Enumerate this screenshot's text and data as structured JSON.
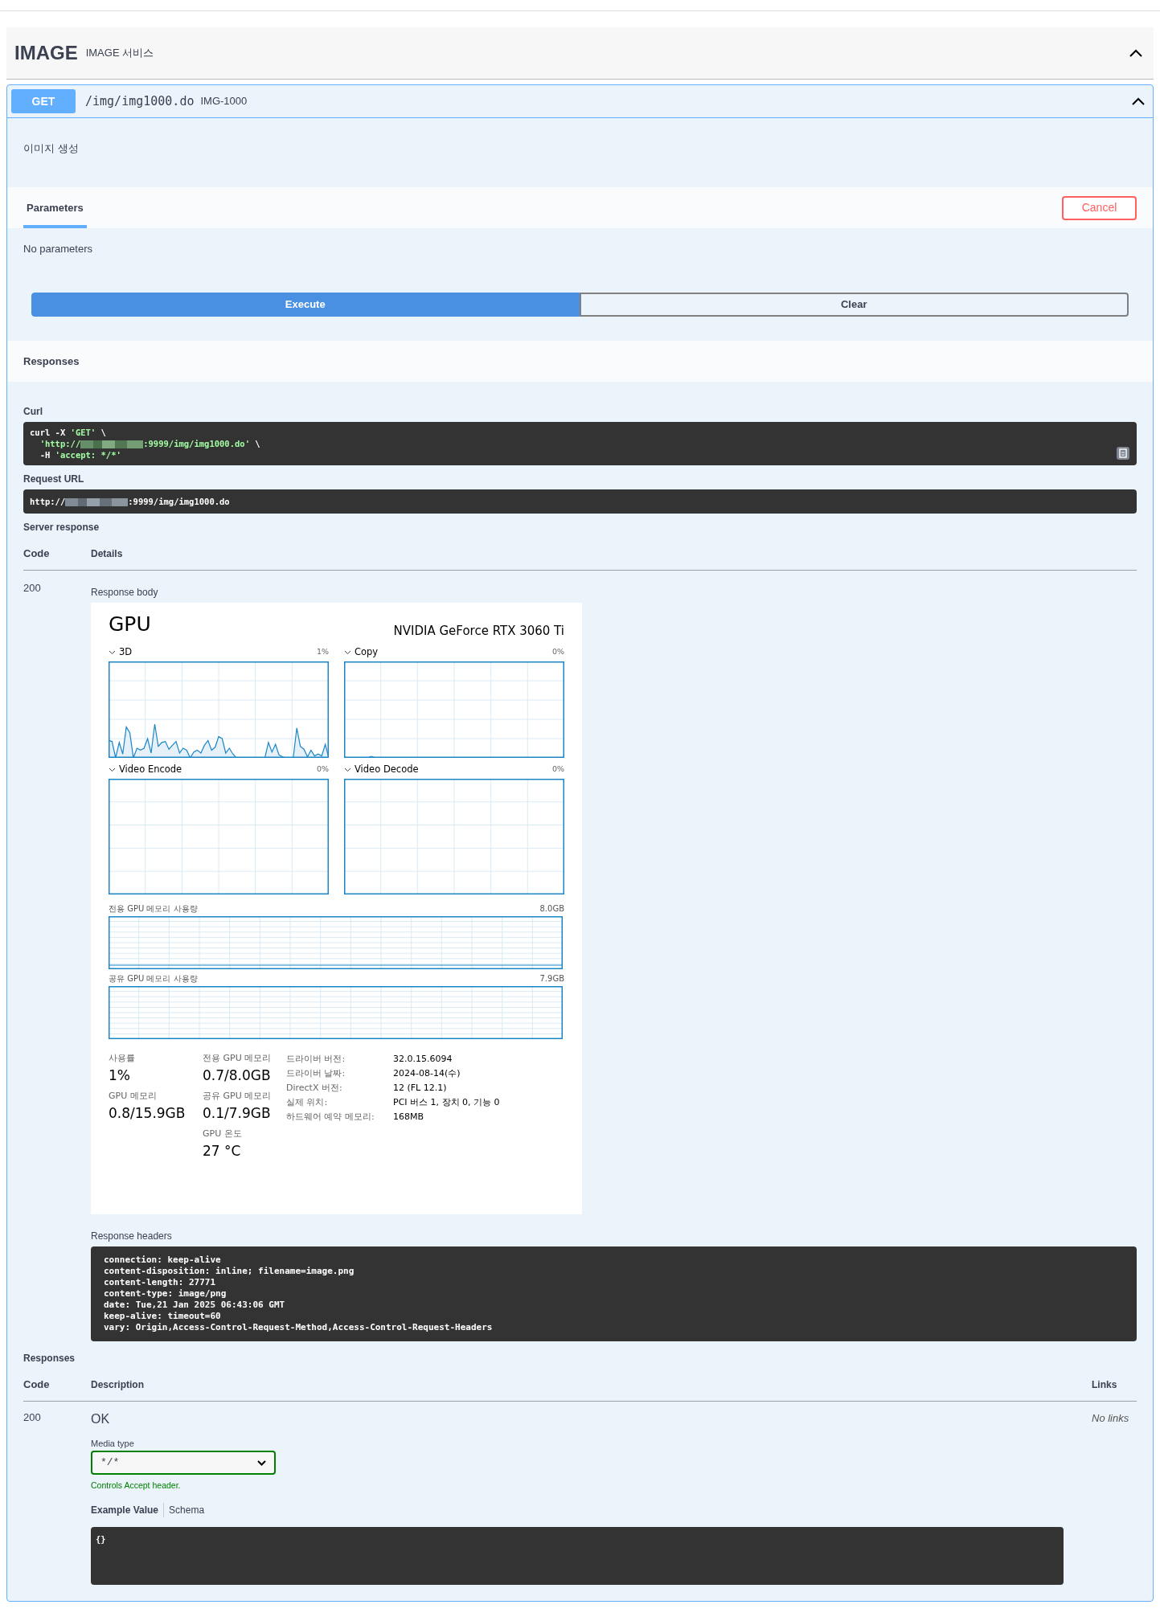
{
  "tag": {
    "name": "IMAGE",
    "description": "IMAGE 서비스",
    "expanded": true
  },
  "operation": {
    "method": "GET",
    "path": "/img/img1000.do",
    "summary": "IMG-1000",
    "expanded": true,
    "description": "이미지 생성"
  },
  "parameters": {
    "tab": {
      "label": "Parameters",
      "selected": true
    },
    "cancel": "Cancel",
    "empty": "No parameters"
  },
  "actions": [
    {
      "label": "Execute",
      "kind": "primary"
    },
    {
      "label": "Clear",
      "kind": "outline"
    }
  ],
  "responses_bar": "Responses",
  "curl": {
    "label": "Curl",
    "lines": [
      [
        {
          "text": "curl -X "
        },
        {
          "text": "'GET'",
          "kind": "string"
        },
        {
          "text": " \\"
        }
      ],
      [
        {
          "text": "  'http://",
          "kind": "string"
        },
        {
          "kind": "blur"
        },
        {
          "text": ":9999/img/img1000.do'",
          "kind": "string"
        },
        {
          "text": " \\"
        }
      ],
      [
        {
          "text": "  -H "
        },
        {
          "text": "'accept: */*'",
          "kind": "string"
        }
      ]
    ]
  },
  "request_url": {
    "label": "Request URL",
    "parts": [
      {
        "text": "http://"
      },
      {
        "kind": "blur"
      },
      {
        "text": ":9999/img/img1000.do"
      }
    ]
  },
  "server_response": {
    "label": "Server response",
    "columns": [
      "Code",
      "Details"
    ],
    "code": "200",
    "body_label": "Response body",
    "gpu": {
      "title": "GPU",
      "model": "NVIDIA GeForce RTX 3060 Ti",
      "engines": [
        {
          "name": "3D",
          "reading": "1%",
          "kind": "busy"
        },
        {
          "name": "Copy",
          "reading": "0%",
          "kind": "idle"
        },
        {
          "name": "Video Encode",
          "reading": "0%",
          "kind": "flat"
        },
        {
          "name": "Video Decode",
          "reading": "0%",
          "kind": "flat"
        }
      ],
      "memory_graphs": [
        {
          "label": "전용 GPU 메모리 사용량",
          "reading": "8.0GB"
        },
        {
          "label": "공유 GPU 메모리 사용량",
          "reading": "7.9GB"
        }
      ],
      "stats": [
        [
          {
            "label": "사용률",
            "value": "1%"
          },
          {
            "label": "GPU 메모리",
            "value": "0.8/15.9GB"
          }
        ],
        [
          {
            "label": "전용 GPU 메모리",
            "value": "0.7/8.0GB"
          },
          {
            "label": "공유 GPU 메모리",
            "value": "0.1/7.9GB"
          },
          {
            "label": "GPU 온도",
            "value": "27 °C"
          }
        ]
      ],
      "details": [
        {
          "label": "드라이버 버전:",
          "value": "32.0.15.6094"
        },
        {
          "label": "드라이버 날짜:",
          "value": "2024-08-14(수)"
        },
        {
          "label": "DirectX 버전:",
          "value": "12 (FL 12.1)"
        },
        {
          "label": "실제 위치:",
          "value": "PCI 버스 1, 장치 0, 기능 0"
        },
        {
          "label": "하드웨어 예약 메모리:",
          "value": "168MB"
        }
      ]
    },
    "headers_label": "Response headers",
    "headers": [
      "connection: keep-alive",
      "content-disposition: inline; filename=image.png",
      "content-length: 27771",
      "content-type: image/png",
      "date: Tue,21 Jan 2025 06:43:06 GMT",
      "keep-alive: timeout=60",
      "vary: Origin,Access-Control-Request-Method,Access-Control-Request-Headers"
    ]
  },
  "responses": {
    "label": "Responses",
    "columns": [
      "Code",
      "Description",
      "Links"
    ],
    "rows": [
      {
        "code": "200",
        "description": "OK",
        "links": "No links",
        "media_label": "Media type",
        "media_value": "*/*",
        "media_hint": "Controls Accept header.",
        "example_tabs": [
          {
            "label": "Example Value",
            "selected": true
          },
          {
            "label": "Schema",
            "selected": false
          }
        ],
        "example": "{}"
      }
    ]
  }
}
